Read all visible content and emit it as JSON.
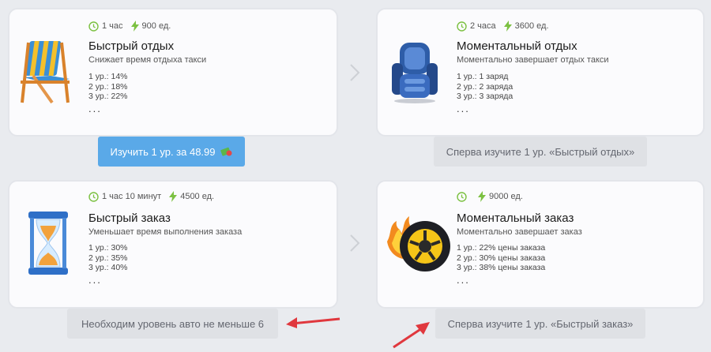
{
  "cards": [
    {
      "time": "1 час",
      "cost": "900 ед.",
      "title": "Быстрый отдых",
      "description": "Снижает время отдыха такси",
      "levels": [
        "1 ур.: 14%",
        "2 ур.: 18%",
        "3 ур.: 22%"
      ],
      "more": "...",
      "image": "beach-chair"
    },
    {
      "time": "2 часа",
      "cost": "3600 ед.",
      "title": "Моментальный отдых",
      "description": "Моментально завершает отдых такси",
      "levels": [
        "1 ур.: 1 заряд",
        "2 ур.: 2 заряда",
        "3 ур.: 3 заряда"
      ],
      "more": "...",
      "image": "car-seat"
    },
    {
      "time": "1 час 10 минут",
      "cost": "4500 ед.",
      "title": "Быстрый заказ",
      "description": "Уменьшает время выполнения заказа",
      "levels": [
        "1 ур.: 30%",
        "2 ур.: 35%",
        "3 ур.: 40%"
      ],
      "more": "...",
      "image": "hourglass"
    },
    {
      "time": "",
      "cost": "9000 ед.",
      "title": "Моментальный заказ",
      "description": "Моментально завершает заказ",
      "levels": [
        "1 ур.: 22% цены заказа",
        "2 ур.: 30% цены заказа",
        "3 ур.: 38% цены заказа"
      ],
      "more": "...",
      "image": "flaming-wheel"
    }
  ],
  "buttons": {
    "learn_fast_rest": "Изучить 1 ур. за 48.99",
    "req_fast_rest": "Сперва изучите 1 ур. «Быстрый отдых»",
    "req_car_level": "Необходим уровень авто не меньше 6",
    "req_fast_order": "Сперва изучите 1 ур. «Быстрый заказ»"
  },
  "colors": {
    "accent_green": "#7cc142",
    "button_blue": "#5aa9e8",
    "button_gray": "#dfe1e5",
    "arrow_red": "#e0383e"
  }
}
